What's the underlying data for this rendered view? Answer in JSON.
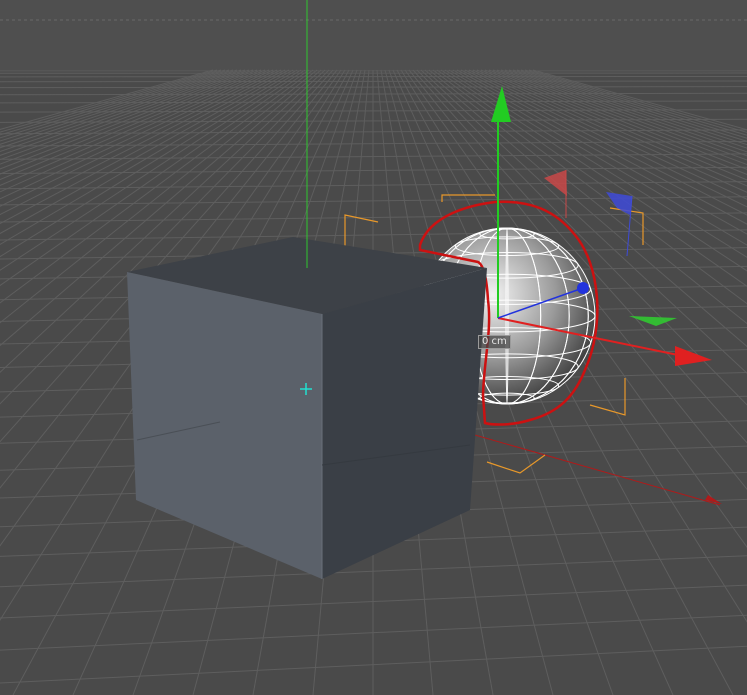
{
  "viewport": {
    "background": "#4a4a4a",
    "sky": "#4f4f4f",
    "grid_color": "#5c5c5c",
    "objects": [
      {
        "name": "cube",
        "color": "#5b616a"
      },
      {
        "name": "sphere",
        "wireframe": true,
        "selected": true
      }
    ],
    "gizmo": {
      "x_axis": "#e02020",
      "y_axis": "#22cc22",
      "z_axis": "#2233dd"
    },
    "selection_outline": "#cc1111",
    "bounding_box_color": "#e8982a"
  },
  "readout": {
    "value": "0 cm"
  }
}
